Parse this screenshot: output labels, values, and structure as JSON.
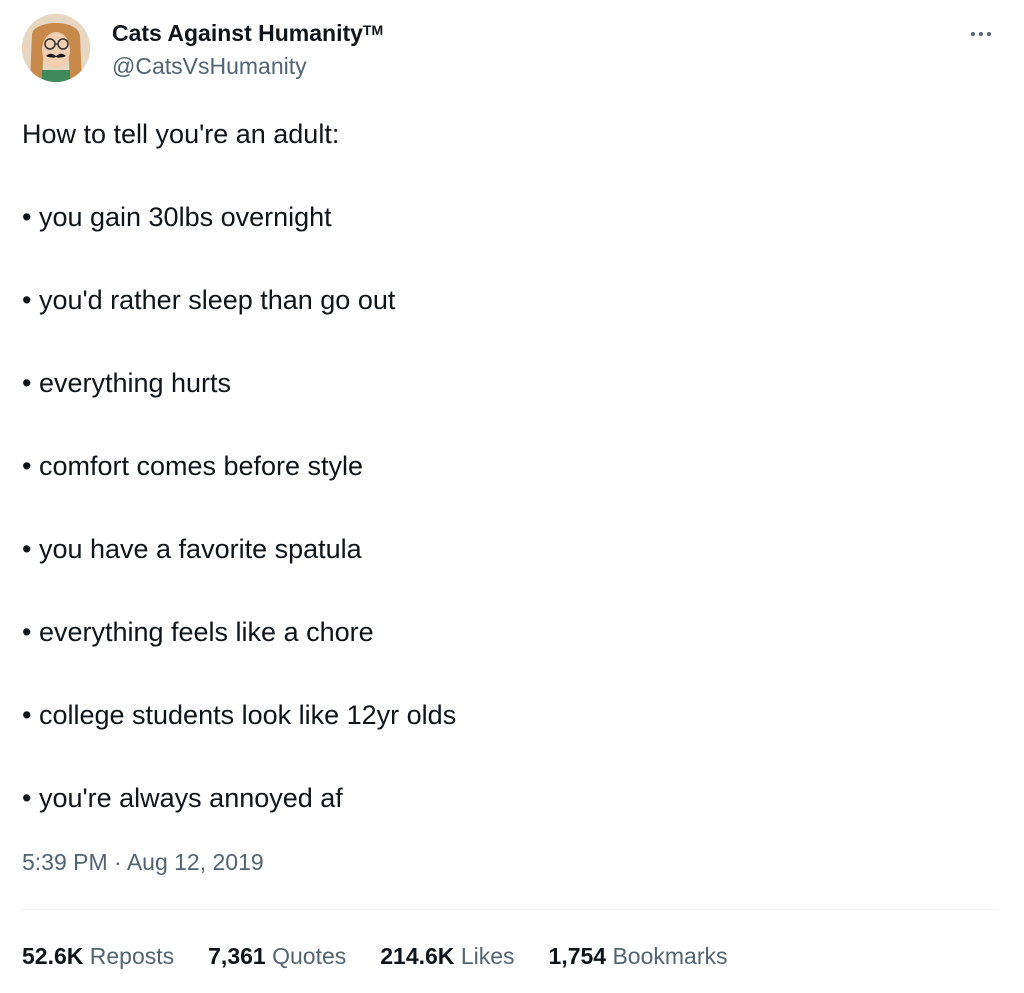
{
  "author": {
    "display_name": "Cats Against Humanity",
    "trademark": "TM",
    "handle": "@CatsVsHumanity"
  },
  "tweet": {
    "intro": "How to tell you're an adult:",
    "bullets": [
      "• you gain 30lbs overnight",
      "• you'd rather sleep than go out",
      "• everything hurts",
      "• comfort comes before style",
      "• you have a favorite spatula",
      "• everything feels like a chore",
      "• college students look like 12yr olds",
      "• you're always annoyed af"
    ],
    "timestamp": "5:39 PM · Aug 12, 2019"
  },
  "stats": {
    "reposts": {
      "count": "52.6K",
      "label": "Reposts"
    },
    "quotes": {
      "count": "7,361",
      "label": "Quotes"
    },
    "likes": {
      "count": "214.6K",
      "label": "Likes"
    },
    "bookmarks": {
      "count": "1,754",
      "label": "Bookmarks"
    }
  },
  "icons": {
    "more": "more-options-icon"
  },
  "colors": {
    "text_primary": "#0f1419",
    "text_secondary": "#536471",
    "divider": "#eff3f4"
  }
}
